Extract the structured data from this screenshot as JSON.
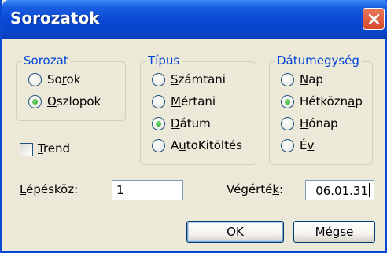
{
  "window": {
    "title": "Sorozatok"
  },
  "groups": {
    "sorozat": {
      "legend": "Sorozat",
      "options": [
        {
          "label": "Sorok",
          "hotkey_index": 2,
          "selected": false
        },
        {
          "label": "Oszlopok",
          "hotkey_index": 0,
          "selected": true
        }
      ]
    },
    "tipus": {
      "legend": "Típus",
      "options": [
        {
          "label": "Számtani",
          "hotkey_index": 0,
          "selected": false
        },
        {
          "label": "Mértani",
          "hotkey_index": 0,
          "selected": false
        },
        {
          "label": "Dátum",
          "hotkey_index": 0,
          "selected": true
        },
        {
          "label": "AutoKitöltés",
          "hotkey_index": 1,
          "selected": false
        }
      ]
    },
    "datumegyseg": {
      "legend": "Dátumegység",
      "options": [
        {
          "label": "Nap",
          "hotkey_index": 0,
          "selected": false
        },
        {
          "label": "Hétköznap",
          "hotkey_index": 7,
          "selected": true
        },
        {
          "label": "Hónap",
          "hotkey_index": 0,
          "selected": false
        },
        {
          "label": "Év",
          "hotkey_index": 1,
          "selected": false
        }
      ]
    }
  },
  "trend": {
    "label": "Trend",
    "checked": false
  },
  "step": {
    "label": "Lépésköz:",
    "value": "1"
  },
  "stop": {
    "label": "Végérték:",
    "value": "06.01.31"
  },
  "buttons": {
    "ok": "OK",
    "cancel": "Mégse"
  },
  "colors": {
    "title_bar": "#0a48d6",
    "legend_text": "#0046d5",
    "radio_dot": "#21a121",
    "close": "#d6492a"
  }
}
